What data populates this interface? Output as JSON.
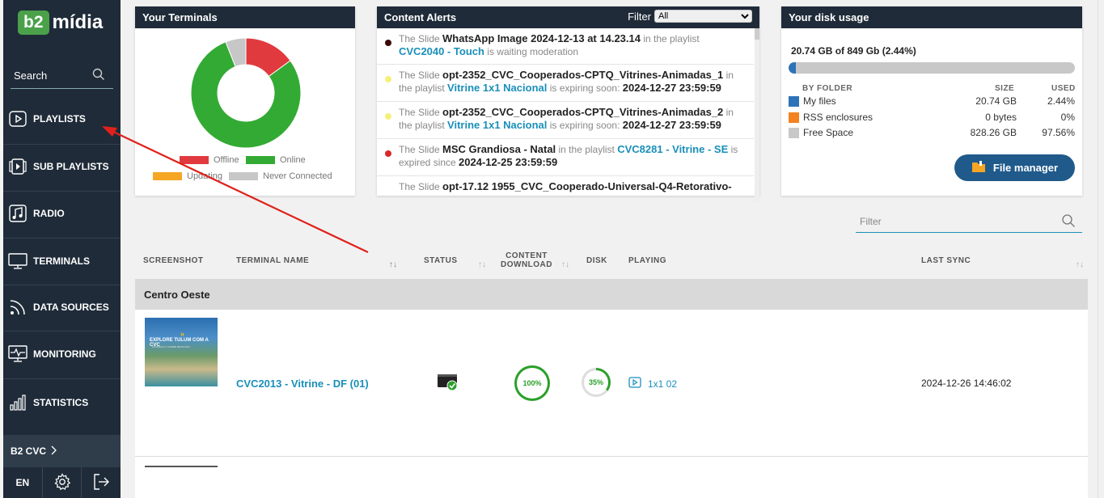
{
  "app": {
    "logo_box": "b2",
    "logo_text": "mídia"
  },
  "sidebar": {
    "search_label": "Search",
    "items": [
      {
        "label": "PLAYLISTS",
        "icon": "play-square-icon"
      },
      {
        "label": "SUB PLAYLISTS",
        "icon": "sub-playlists-icon"
      },
      {
        "label": "RADIO",
        "icon": "music-note-icon"
      },
      {
        "label": "TERMINALS",
        "icon": "monitor-icon"
      },
      {
        "label": "DATA SOURCES",
        "icon": "rss-icon"
      },
      {
        "label": "MONITORING",
        "icon": "heartbeat-monitor-icon"
      },
      {
        "label": "STATISTICS",
        "icon": "bar-chart-icon"
      }
    ],
    "org": "B2 CVC",
    "lang": "EN"
  },
  "terminals_card": {
    "title": "Your Terminals",
    "legend": [
      {
        "label": "Offline",
        "color": "#e03a3e"
      },
      {
        "label": "Online",
        "color": "#33aa33"
      },
      {
        "label": "Updating",
        "color": "#f5a623"
      },
      {
        "label": "Never Connected",
        "color": "#c7c7c7"
      }
    ],
    "chart_data": {
      "type": "pie",
      "categories": [
        "Offline",
        "Online",
        "Updating",
        "Never Connected"
      ],
      "values": [
        15,
        79,
        0,
        6
      ],
      "colors": [
        "#e03a3e",
        "#33aa33",
        "#f5a623",
        "#c7c7c7"
      ]
    }
  },
  "alerts_card": {
    "title": "Content Alerts",
    "filter_label": "Filter",
    "filter_value": "All",
    "alerts": [
      {
        "dot": "#3a0a0a",
        "pre": "The Slide ",
        "slide": "WhatsApp Image 2024-12-13 at 14.23.14",
        "mid": " in the playlist ",
        "playlist": "CVC2040 - Touch",
        "post": " is waiting moderation",
        "date": ""
      },
      {
        "dot": "#f5f07a",
        "pre": "The Slide ",
        "slide": "opt-2352_CVC_Cooperados-CPTQ_Vitrines-Animadas_1",
        "mid": " in the playlist ",
        "playlist": "Vitrine 1x1 Nacional",
        "post": " is expiring soon: ",
        "date": "2024-12-27 23:59:59"
      },
      {
        "dot": "#f5f07a",
        "pre": "The Slide ",
        "slide": "opt-2352_CVC_Cooperados-CPTQ_Vitrines-Animadas_2",
        "mid": " in the playlist ",
        "playlist": "Vitrine 1x1 Nacional",
        "post": " is expiring soon: ",
        "date": "2024-12-27 23:59:59"
      },
      {
        "dot": "#d62a2a",
        "pre": "The Slide ",
        "slide": "MSC Grandiosa - Natal",
        "mid": " in the playlist ",
        "playlist": "CVC8281 - Vitrine - SE",
        "post": " is expired since ",
        "date": "2024-12-25 23:59:59"
      },
      {
        "dot": "#ffffff",
        "pre": "The Slide ",
        "slide": "opt-17.12 1955_CVC_Cooperado-Universal-Q4-Retorativo-",
        "mid": "",
        "playlist": "",
        "post": "",
        "date": ""
      }
    ]
  },
  "disk_card": {
    "title": "Your disk usage",
    "total": "20.74 GB of 849 Gb (2.44%)",
    "used_fraction": 0.0244,
    "headers": {
      "folder": "BY FOLDER",
      "size": "SIZE",
      "used": "USED"
    },
    "rows": [
      {
        "name": "My files",
        "size": "20.74 GB",
        "used": "2.44%",
        "color": "#2e73b8"
      },
      {
        "name": "RSS enclosures",
        "size": "0 bytes",
        "used": "0%",
        "color": "#f58220"
      },
      {
        "name": "Free Space",
        "size": "828.26 GB",
        "used": "97.56%",
        "color": "#c8c8c8"
      }
    ],
    "button": "File manager"
  },
  "table": {
    "filter_placeholder": "Filter",
    "headers": {
      "screenshot": "SCREENSHOT",
      "terminal_name": "TERMINAL NAME",
      "status": "STATUS",
      "content_download_1": "CONTENT",
      "content_download_2": "DOWNLOAD",
      "disk": "DISK",
      "playing": "PLAYING",
      "last_sync": "LAST SYNC"
    },
    "group": "Centro Oeste",
    "rows": [
      {
        "thumb_title": "EXPLORE TULUM COM A CVC",
        "thumb_sub": "CONHEÇA O CARIBE MEXICANO",
        "terminal": "CVC2013 - Vitrine - DF (01)",
        "status": "online",
        "content_download": "100%",
        "content_download_fraction": 1.0,
        "disk": "35%",
        "disk_fraction": 0.35,
        "playing": "1x1 02",
        "last_sync": "2024-12-26 14:46:02"
      }
    ]
  }
}
